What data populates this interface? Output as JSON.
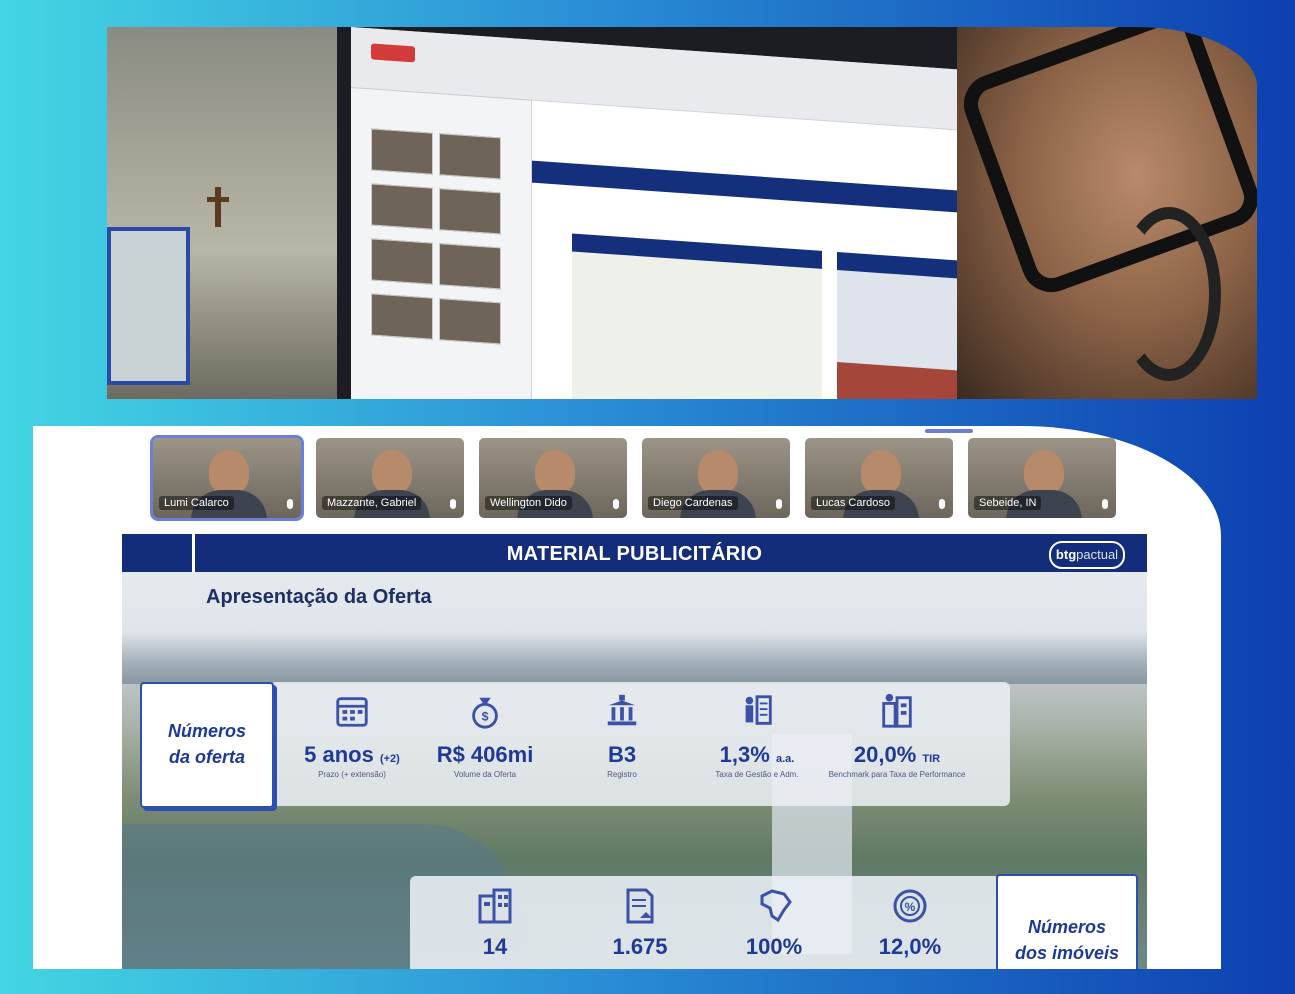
{
  "meeting": {
    "participants": [
      {
        "name": "Lumi Calarco",
        "active": true
      },
      {
        "name": "Mazzante, Gabriel",
        "active": false
      },
      {
        "name": "Wellington Dido",
        "active": false
      },
      {
        "name": "Diego Cardenas",
        "active": false
      },
      {
        "name": "Lucas Cardoso",
        "active": false
      },
      {
        "name": "Sebeide, IN",
        "active": false
      }
    ]
  },
  "slide": {
    "header_title": "MATERIAL PUBLICITÁRIO",
    "logo_main": "btg",
    "logo_sub": "pactual",
    "subtitle": "Apresentação da Oferta",
    "offer_box_label": "Números\nda oferta",
    "offer_stats": [
      {
        "icon": "calendar-icon",
        "value": "5 anos",
        "suffix": "(+2)",
        "caption": "Prazo (+ extensão)"
      },
      {
        "icon": "money-bag-icon",
        "value": "R$ 406mi",
        "suffix": "",
        "caption": "Volume da Oferta"
      },
      {
        "icon": "registry-building-icon",
        "value": "B3",
        "suffix": "",
        "caption": "Registro"
      },
      {
        "icon": "management-people-icon",
        "value": "1,3%",
        "suffix": "a.a.",
        "caption": "Taxa de Gestão e Adm."
      },
      {
        "icon": "performance-building-icon",
        "value": "20,0%",
        "suffix": "TIR",
        "caption": "Benchmark para Taxa de Performance"
      }
    ],
    "property_box_label": "Números\ndos imóveis",
    "property_stats": [
      {
        "icon": "buildings-icon",
        "value": "14"
      },
      {
        "icon": "document-home-icon",
        "value": "1.675"
      },
      {
        "icon": "brazil-map-icon",
        "value": "100%"
      },
      {
        "icon": "percentage-badge-icon",
        "value": "12,0%"
      }
    ]
  },
  "colors": {
    "brand_navy": "#142d7a",
    "brand_blue": "#1e3a96",
    "active_outline": "#6b7fd6"
  }
}
